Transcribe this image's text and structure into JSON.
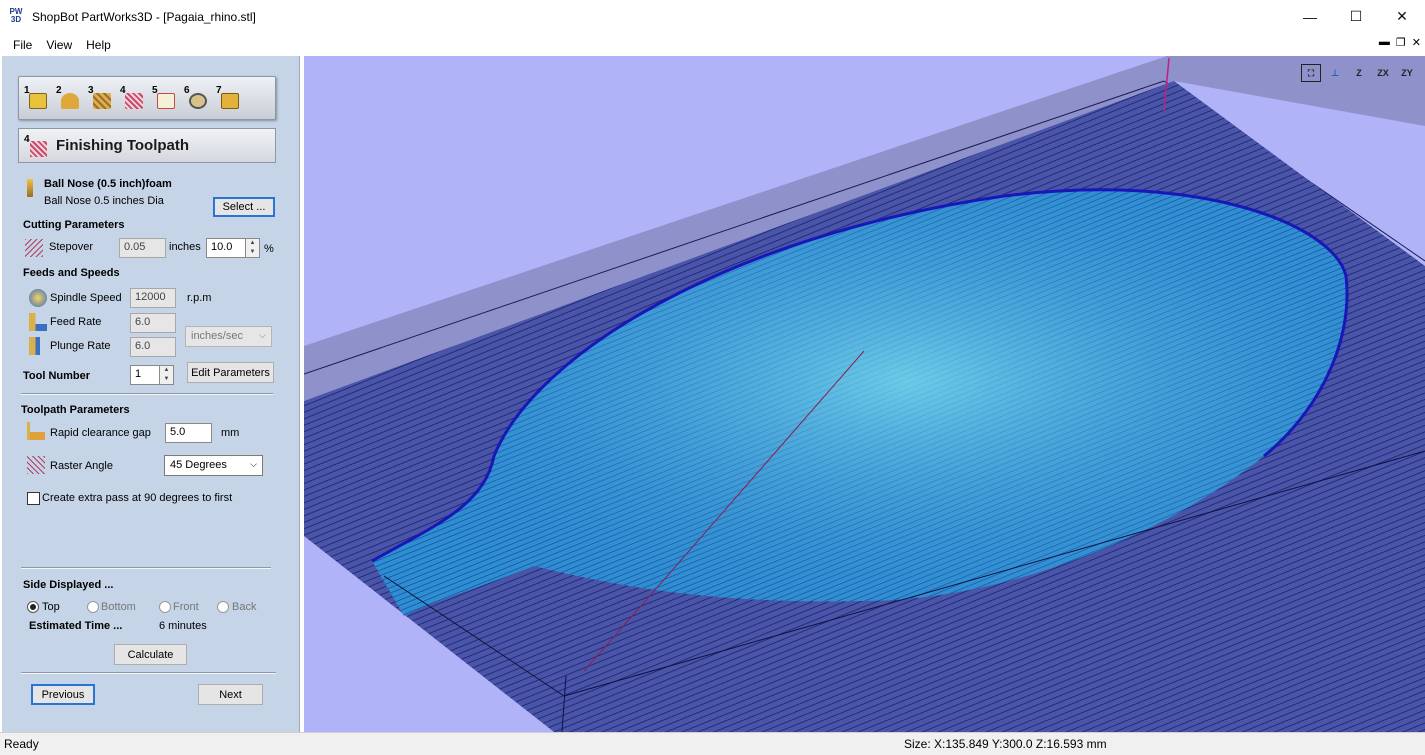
{
  "window": {
    "app_icon_text": "PW 3D",
    "title": "ShopBot PartWorks3D - [Pagaia_rhino.stl]",
    "minimize": "—",
    "maximize": "☐",
    "close": "✕"
  },
  "menu": {
    "file": "File",
    "view": "View",
    "help": "Help"
  },
  "steps": [
    "1",
    "2",
    "3",
    "4",
    "5",
    "6",
    "7"
  ],
  "panel": {
    "heading_num": "4",
    "heading": "Finishing Toolpath",
    "tool": {
      "name": "Ball Nose (0.5 inch)foam",
      "description": "Ball Nose 0.5 inches Dia",
      "select_label": "Select ..."
    },
    "cutting": {
      "heading": "Cutting Parameters",
      "stepover_label": "Stepover",
      "stepover_value": "0.05",
      "stepover_unit": "inches",
      "stepover_percent": "10.0",
      "percent_sign": "%"
    },
    "feeds": {
      "heading": "Feeds and Speeds",
      "spindle_label": "Spindle Speed",
      "spindle_value": "12000",
      "spindle_unit": "r.p.m",
      "feed_label": "Feed Rate",
      "feed_value": "6.0",
      "plunge_label": "Plunge Rate",
      "plunge_value": "6.0",
      "rate_unit": "inches/sec"
    },
    "tool_number": {
      "label": "Tool Number",
      "value": "1",
      "edit_label": "Edit Parameters"
    },
    "toolpath": {
      "heading": "Toolpath Parameters",
      "rapid_label": "Rapid clearance gap",
      "rapid_value": "5.0",
      "rapid_unit": "mm",
      "raster_label": "Raster Angle",
      "raster_value": "45 Degrees",
      "extra_pass_label": "Create extra pass at 90 degrees to first",
      "extra_pass_checked": false
    },
    "side": {
      "heading": "Side Displayed ...",
      "options": [
        "Top",
        "Bottom",
        "Front",
        "Back"
      ],
      "selected": "Top",
      "estimated_label": "Estimated Time ...",
      "estimated_value": "6 minutes",
      "calculate_label": "Calculate"
    },
    "nav": {
      "previous": "Previous",
      "next": "Next"
    }
  },
  "view_tools": {
    "fit": "⛶",
    "iso": "⊥",
    "z_top": "Z",
    "zx": "ZX",
    "zy": "ZY"
  },
  "status": {
    "left": "Ready",
    "size": "Size: X:135.849 Y:300.0 Z:16.593 mm"
  },
  "colors": {
    "panel_bg": "#c5d4e6",
    "viewport_bg": "#b0b3f7",
    "toolpath": "#1a2bb0",
    "surface": "#2f9fd6"
  }
}
